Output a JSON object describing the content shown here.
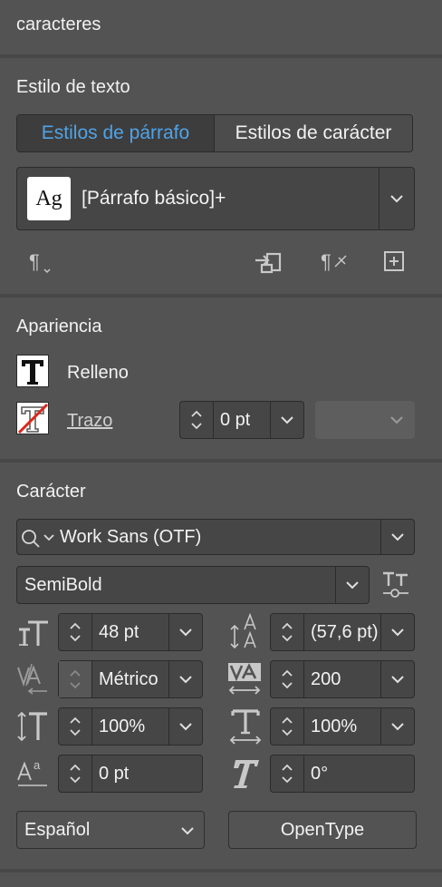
{
  "panel": {
    "header_title": "caracteres"
  },
  "text_style": {
    "title": "Estilo de texto",
    "tabs": [
      {
        "label": "Estilos de párrafo",
        "active": true
      },
      {
        "label": "Estilos de carácter",
        "active": false
      }
    ],
    "current_style": "[Párrafo básico]+",
    "preview_glyph": "Ag"
  },
  "appearance": {
    "title": "Apariencia",
    "fill_label": "Relleno",
    "stroke_label": "Trazo",
    "stroke_weight": "0 pt",
    "stroke_type": ""
  },
  "character": {
    "title": "Carácter",
    "font_family": "Work Sans (OTF)",
    "font_style": "SemiBold",
    "font_size": "48 pt",
    "leading": "(57,6 pt)",
    "kerning": "Métrico",
    "tracking": "200",
    "vertical_scale": "100%",
    "horizontal_scale": "100%",
    "baseline_shift": "0 pt",
    "skew": "0°",
    "language": "Español",
    "opentype_button": "OpenType"
  },
  "colors": {
    "panel_bg": "#535353",
    "field_bg": "#464646",
    "active_tab_text": "#4fa3e8",
    "divider": "#474747"
  }
}
